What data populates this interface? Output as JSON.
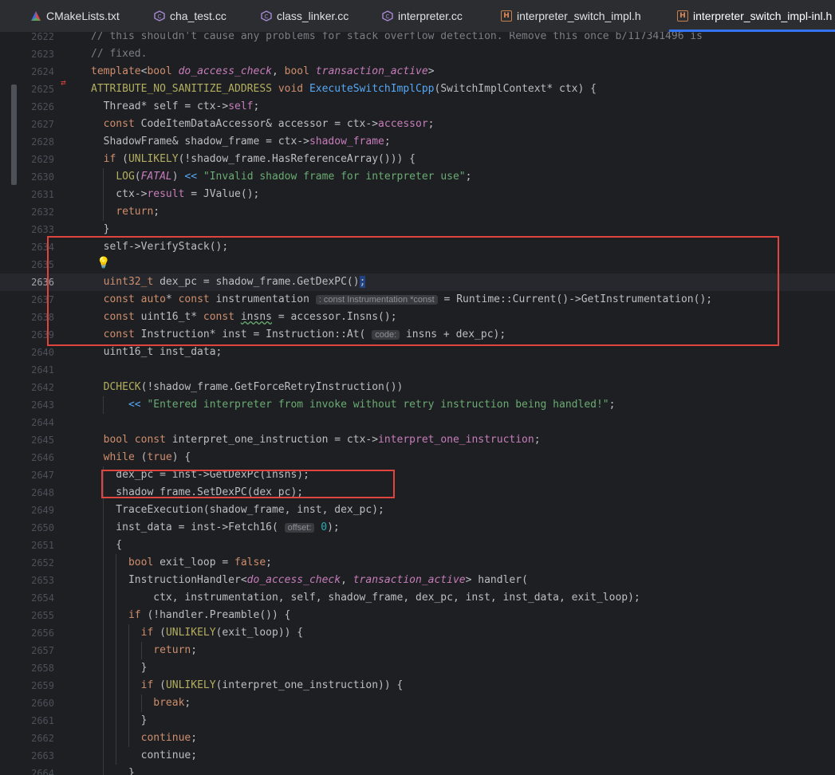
{
  "tabs": [
    {
      "label": "CMakeLists.txt",
      "icon": "cmake-icon"
    },
    {
      "label": "cha_test.cc",
      "icon": "cpp-file-icon"
    },
    {
      "label": "class_linker.cc",
      "icon": "cpp-file-icon"
    },
    {
      "label": "interpreter.cc",
      "icon": "cpp-file-icon"
    },
    {
      "label": "interpreter_switch_impl.h",
      "icon": "header-file-icon"
    },
    {
      "label": "interpreter_switch_impl-inl.h",
      "icon": "header-file-icon",
      "active": true
    }
  ],
  "hints": {
    "instrumentation_type": ": const Instrumentation *const",
    "code_param": "code:",
    "offset_param": "offset:"
  },
  "line_numbers": [
    "2622",
    "2623",
    "2624",
    "2625",
    "2626",
    "2627",
    "2628",
    "2629",
    "2630",
    "2631",
    "2632",
    "2633",
    "2634",
    "2635",
    "2636",
    "2637",
    "2638",
    "2639",
    "2640",
    "2641",
    "2642",
    "2643",
    "2644",
    "2645",
    "2646",
    "2647",
    "2648",
    "2649",
    "2650",
    "2651",
    "2652",
    "2653",
    "2654",
    "2655",
    "2656",
    "2657",
    "2658",
    "2659",
    "2660",
    "2661",
    "2662",
    "2663",
    "2664"
  ],
  "current_line": "2636",
  "lines": [
    "// this shouldn't cause any problems for stack overflow detection. Remove this once b/117341496 is",
    "// fixed.",
    "template<bool do_access_check, bool transaction_active>",
    "ATTRIBUTE_NO_SANITIZE_ADDRESS void ExecuteSwitchImplCpp(SwitchImplContext* ctx) {",
    "  Thread* self = ctx->self;",
    "  const CodeItemDataAccessor& accessor = ctx->accessor;",
    "  ShadowFrame& shadow_frame = ctx->shadow_frame;",
    "  if (UNLIKELY(!shadow_frame.HasReferenceArray())) {",
    "    LOG(FATAL) << \"Invalid shadow frame for interpreter use\";",
    "    ctx->result = JValue();",
    "    return;",
    "  }",
    "  self->VerifyStack();",
    "",
    "  uint32_t dex_pc = shadow_frame.GetDexPC();",
    "  const auto* const instrumentation = Runtime::Current()->GetInstrumentation();",
    "  const uint16_t* const insns = accessor.Insns();",
    "  const Instruction* inst = Instruction::At( insns + dex_pc);",
    "  uint16_t inst_data;",
    "",
    "  DCHECK(!shadow_frame.GetForceRetryInstruction())",
    "      << \"Entered interpreter from invoke without retry instruction being handled!\";",
    "",
    "  bool const interpret_one_instruction = ctx->interpret_one_instruction;",
    "  while (true) {",
    "    dex_pc = inst->GetDexPc(insns);",
    "    shadow_frame.SetDexPC(dex_pc);",
    "    TraceExecution(shadow_frame, inst, dex_pc);",
    "    inst_data = inst->Fetch16( 0);",
    "    {",
    "      bool exit_loop = false;",
    "      InstructionHandler<do_access_check, transaction_active> handler(",
    "          ctx, instrumentation, self, shadow_frame, dex_pc, inst, inst_data, exit_loop);",
    "      if (!handler.Preamble()) {",
    "        if (UNLIKELY(exit_loop)) {",
    "          return;",
    "        }",
    "        if (UNLIKELY(interpret_one_instruction)) {",
    "          break;",
    "        }",
    "        continue;",
    "      }",
    "  }"
  ]
}
